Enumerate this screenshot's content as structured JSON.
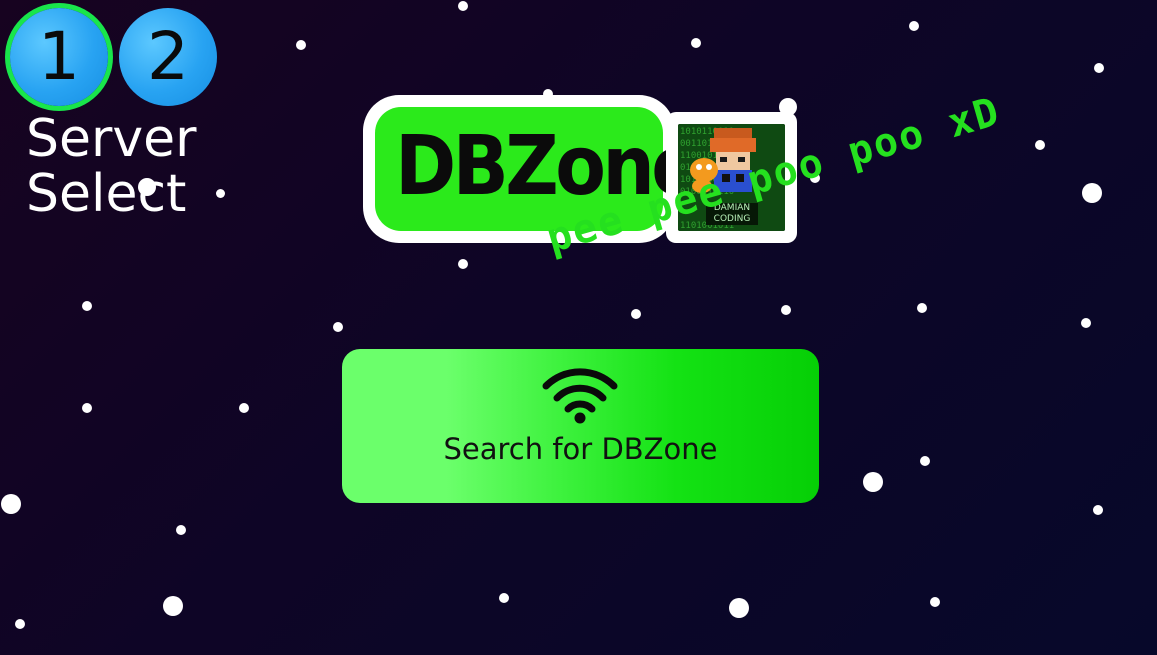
{
  "server_select": {
    "slots": [
      {
        "number": "1",
        "active": true
      },
      {
        "number": "2",
        "active": false
      }
    ],
    "label": "Server Select"
  },
  "logo": {
    "title": "DBZone",
    "avatar_caption": "DAMIAN CODING",
    "tagline": "pee pee poo poo xD"
  },
  "search": {
    "label": "Search for DBZone",
    "icon": "wifi-icon"
  },
  "colors": {
    "background": "#10051f",
    "slot_blue": "#28a3f2",
    "slot_active_ring": "#19e54b",
    "logo_green": "#2bea1b",
    "tagline_green": "#25e01f",
    "button_green_light": "#6bff6b",
    "button_green_dark": "#06cf06"
  }
}
